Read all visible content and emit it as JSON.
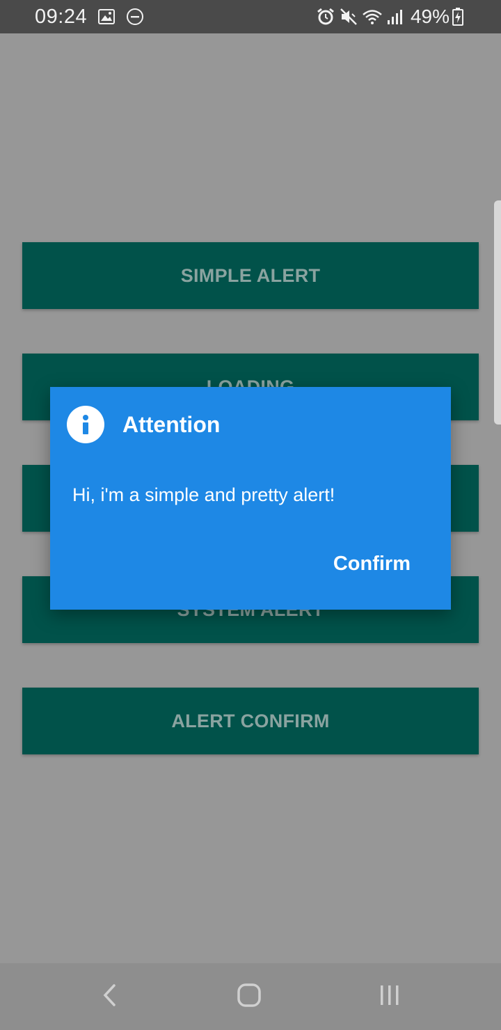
{
  "status_bar": {
    "time": "09:24",
    "battery": "49%",
    "icons_left": [
      "image-icon",
      "dnd-icon"
    ],
    "icons_right": [
      "alarm-icon",
      "mute-icon",
      "wifi-icon",
      "signal-icon",
      "battery-icon"
    ]
  },
  "buttons": [
    {
      "label": "SIMPLE ALERT"
    },
    {
      "label": "LOADING"
    },
    {
      "label": ""
    },
    {
      "label": "SYSTEM ALERT"
    },
    {
      "label": "ALERT CONFIRM"
    }
  ],
  "dialog": {
    "title": "Attention",
    "message": "Hi, i'm a simple and pretty alert!",
    "confirm_label": "Confirm",
    "icon": "info-icon"
  },
  "nav_bar": {
    "icons": [
      "back-icon",
      "home-icon",
      "recents-icon"
    ]
  },
  "colors": {
    "overlay_bg": "#979797",
    "button_bg": "#01524a",
    "button_text": "#8aa3a0",
    "dialog_bg": "#1e88e5",
    "status_bar_bg": "#4a4a4a"
  }
}
